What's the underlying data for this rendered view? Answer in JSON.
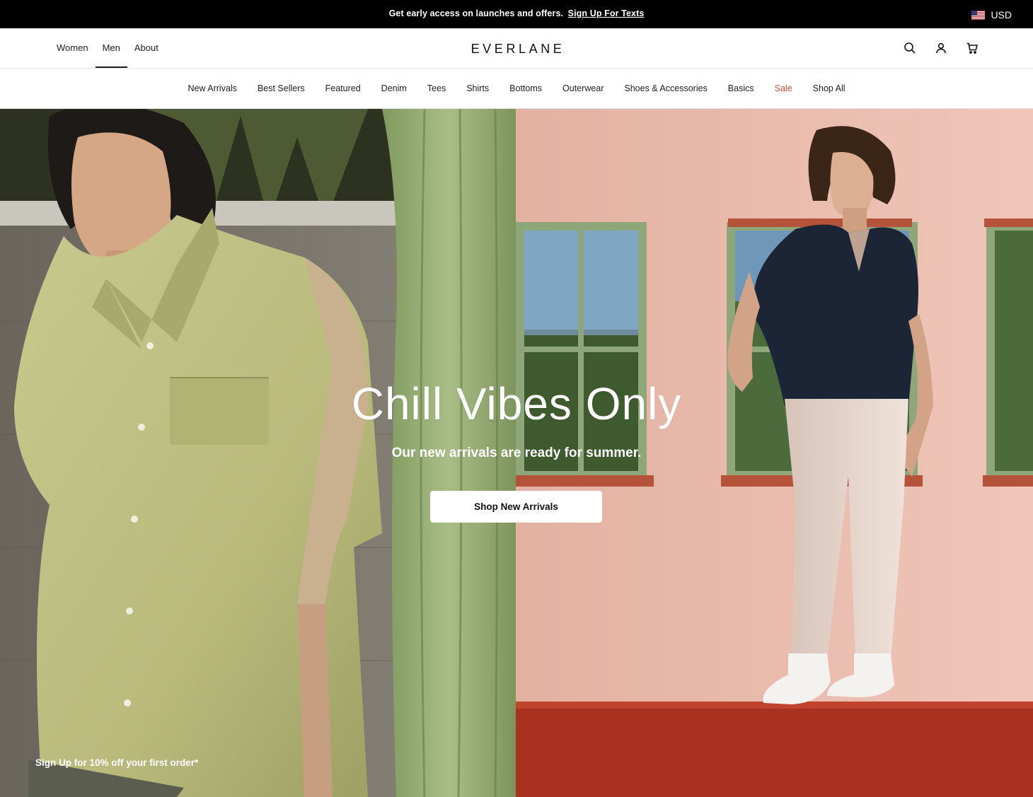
{
  "promo": {
    "message": "Get early access on launches and offers.",
    "link_label": "Sign Up For Texts",
    "currency": "USD",
    "flag_icon": "us-flag-icon"
  },
  "header": {
    "nav": [
      "Women",
      "Men",
      "About"
    ],
    "active_nav": "Men",
    "logo": "EVERLANE",
    "icons": [
      "search-icon",
      "account-icon",
      "cart-icon"
    ]
  },
  "categories": [
    "New Arrivals",
    "Best Sellers",
    "Featured",
    "Denim",
    "Tees",
    "Shirts",
    "Bottoms",
    "Outerwear",
    "Shoes & Accessories",
    "Basics",
    "Sale",
    "Shop All"
  ],
  "hero": {
    "title": "Chill Vibes Only",
    "subtitle": "Our new arrivals are ready for summer.",
    "cta": "Shop New Arrivals"
  },
  "footer_signup": "Sign Up for 10% off your first order*",
  "colors": {
    "promo_bg": "#000000",
    "sale": "#c0503a",
    "wall_pink": "#e6b7a6",
    "ledge_red": "#a8321f",
    "shirt_green": "#c3c488",
    "shirt_navy": "#1c2536"
  }
}
